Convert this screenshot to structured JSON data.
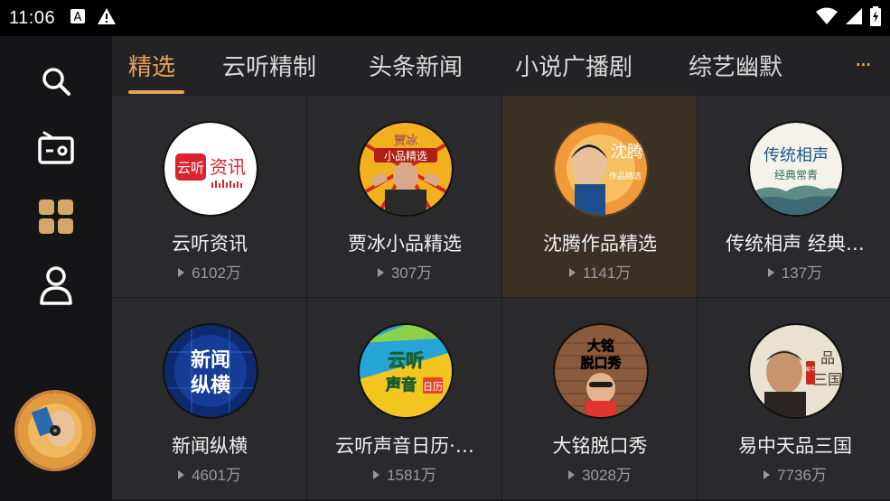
{
  "status_bar": {
    "time": "11:06",
    "icons": [
      "a-notification-icon",
      "warning-icon",
      "wifi-icon",
      "signal-icon",
      "battery-icon"
    ]
  },
  "sidebar": {
    "items": [
      {
        "name": "search-icon"
      },
      {
        "name": "radio-icon"
      },
      {
        "name": "grid-icon"
      },
      {
        "name": "user-icon"
      }
    ],
    "accent": "#d4a866"
  },
  "tabs": [
    {
      "label": "精选",
      "active": true
    },
    {
      "label": "云听精制",
      "active": false
    },
    {
      "label": "头条新闻",
      "active": false
    },
    {
      "label": "小说广播剧",
      "active": false
    },
    {
      "label": "综艺幽默",
      "active": false
    }
  ],
  "more_label": "···",
  "cards": [
    {
      "title": "云听资讯",
      "plays": "6102万",
      "cover_text": "资讯"
    },
    {
      "title": "贾冰小品精选",
      "plays": "307万",
      "cover_text": "贾冰 小品精选"
    },
    {
      "title": "沈腾作品精选",
      "plays": "1141万",
      "cover_text": "沈腾"
    },
    {
      "title": "传统相声 经典…",
      "plays": "137万",
      "cover_text": "传统相声 经典常青"
    },
    {
      "title": "新闻纵横",
      "plays": "4601万",
      "cover_text": "新闻纵横"
    },
    {
      "title": "云听声音日历·…",
      "plays": "1581万",
      "cover_text": "云听 声音日历"
    },
    {
      "title": "大铭脱口秀",
      "plays": "3028万",
      "cover_text": "大铭脱口秀"
    },
    {
      "title": "易中天品三国",
      "plays": "7736万",
      "cover_text": "品三国"
    }
  ],
  "colors": {
    "accent": "#e7a25a",
    "background": "#1e1e20",
    "card": "#2a2a2c",
    "card_highlight": "#3a3024"
  }
}
